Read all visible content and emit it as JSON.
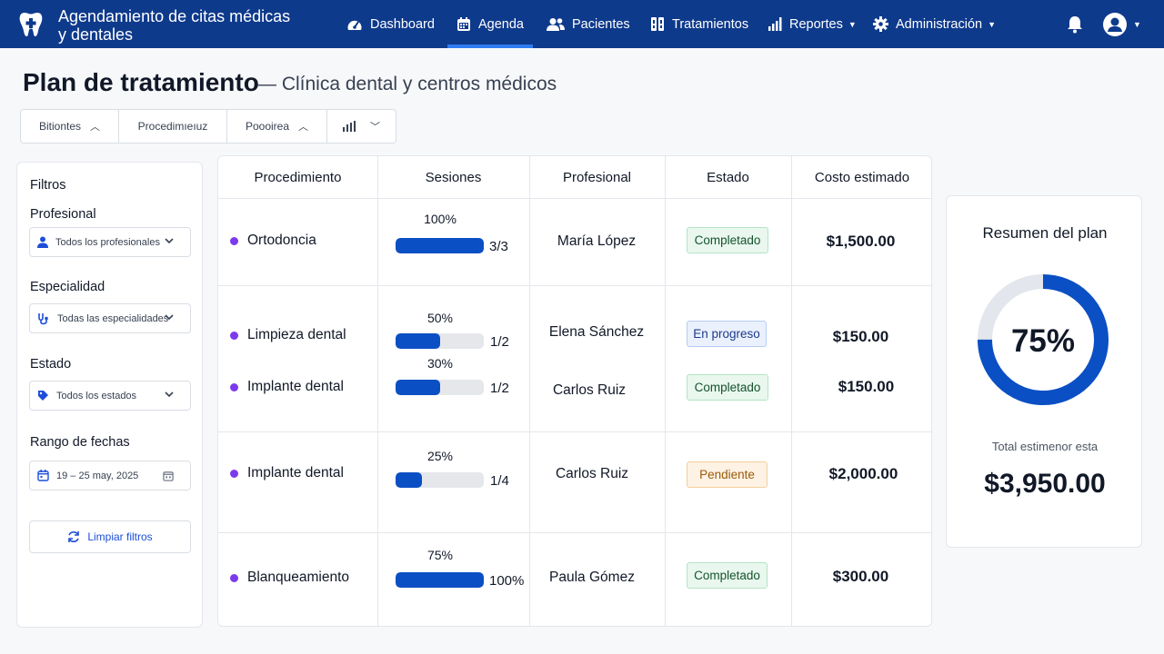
{
  "app": {
    "title": "Agendamiento de citas médicas y dentales",
    "brand_icon": "tooth-icon"
  },
  "nav": {
    "items": [
      {
        "label": "Dashboard",
        "icon": "gauge-icon"
      },
      {
        "label": "Agenda",
        "icon": "calendar-icon",
        "active": true
      },
      {
        "label": "Pacientes",
        "icon": "users-icon"
      },
      {
        "label": "Tratamientos",
        "icon": "treatments-icon"
      },
      {
        "label": "Reportes",
        "icon": "bar-chart-icon",
        "dropdown": true
      },
      {
        "label": "Administración",
        "icon": "gear-icon",
        "dropdown": true
      }
    ]
  },
  "header": {
    "title": "Plan de tratamiento",
    "subtitle": "— Clínica dental y centros médicos"
  },
  "toolbar": {
    "segments": [
      "Bitiontes",
      "Procedimıeıuz",
      "Poooirea",
      ""
    ]
  },
  "filters": {
    "title": "Filtros",
    "profesional_label": "Profesional",
    "profesional_value": "Todos los profesionales",
    "especialidad_label": "Especialidad",
    "especialidad_value": "Todas las especialidades",
    "estado_label": "Estado",
    "estado_value": "Todos los estados",
    "fechas_label": "Rango de fechas",
    "fechas_value": "19 – 25 may, 2025",
    "clear_label": "Limpiar filtros"
  },
  "table": {
    "headers": [
      "Procedimiento",
      "Sesiones",
      "Profesional",
      "Estado",
      "Costo estimado"
    ],
    "rows": [
      {
        "procedure": "Ortodoncia",
        "percent_label": "100%",
        "progress": 1.0,
        "sessions": "3/3",
        "professional": "María López",
        "status": "Completado",
        "status_type": "done",
        "cost": "$1,500.00"
      },
      {
        "procedure": "Limpieza dental",
        "percent_label": "50%",
        "progress": 0.5,
        "sessions": "1/2",
        "professional": "Elena Sánchez",
        "status": "En progreso",
        "status_type": "prog",
        "cost": "$150.00"
      },
      {
        "procedure": "Implante dental",
        "percent_label": "30%",
        "progress": 0.5,
        "sessions": "1/2",
        "professional": "Carlos Ruiz",
        "status": "Completado",
        "status_type": "done",
        "cost": "$150.00"
      },
      {
        "procedure": "Implante dental",
        "percent_label": "25%",
        "progress": 0.3,
        "sessions": "1/4",
        "professional": "Carlos Ruiz",
        "status": "Pendiente",
        "status_type": "pend",
        "cost": "$2,000.00"
      },
      {
        "procedure": "Blanqueamiento",
        "percent_label": "75%",
        "progress": 1.0,
        "sessions": "100%",
        "professional": "Paula Gómez",
        "status": "Completado",
        "status_type": "done",
        "cost": "$300.00"
      }
    ]
  },
  "summary": {
    "title": "Resumen del plan",
    "percent_label": "75%",
    "percent": 0.75,
    "total_label": "Total estimenor esta",
    "total_value": "$3,950.00"
  },
  "colors": {
    "nav_bg": "#0e3a8c",
    "accent": "#0b4fc4",
    "dot": "#7c3aed"
  }
}
